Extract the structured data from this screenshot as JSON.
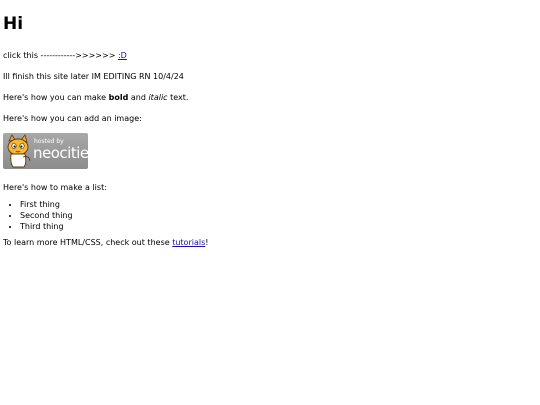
{
  "heading": "Hi",
  "line1": {
    "prefix": "click this ------------>>>>>> ",
    "link": ":D"
  },
  "line2": "Ill finish this site later IM EDITING RN 10/4/24",
  "line3": {
    "before": "Here's how you can make ",
    "bold": "bold",
    "middle": " and ",
    "italic": "italic",
    "after": " text."
  },
  "line4": "Here's how you can add an image:",
  "image": {
    "hosted_by": "hosted by",
    "brand": "neocities"
  },
  "line5": "Here's how to make a list:",
  "list": [
    "First thing",
    "Second thing",
    "Third thing"
  ],
  "line6": {
    "before": "To learn more HTML/CSS, check out these ",
    "link": "tutorials",
    "after": "!"
  },
  "colors": {
    "link": "#1a0dab",
    "badge_bg": "#999999"
  }
}
